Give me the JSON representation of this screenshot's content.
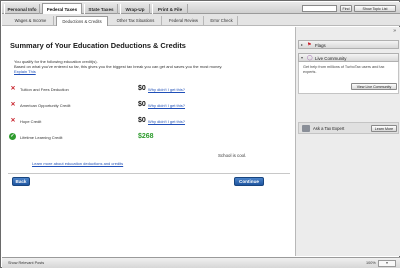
{
  "topbar": {
    "tabs": [
      "Personal Info",
      "Federal Taxes",
      "State Taxes",
      "Wrap-Up",
      "Print & File"
    ],
    "find_label": "Find",
    "topic_list_label": "Show Topic List"
  },
  "subbar": {
    "tabs": [
      "Wages & Income",
      "Deductions & Credits",
      "Other Tax Situations",
      "Federal Review",
      "Error Check"
    ]
  },
  "main": {
    "title": "Summary of Your Education Deductions & Credits",
    "intro1": "You qualify for the following education credit(s).",
    "intro2": "Based on what you've entered so far, this gives you the biggest tax break you can get and saves you the most money.",
    "explain_link": "Explain This",
    "credits": [
      {
        "name": "Tuition and Fees Deduction",
        "amount": "$0",
        "why": "Why didn't I get this?",
        "status": "x"
      },
      {
        "name": "American Opportunity Credit",
        "amount": "$0",
        "why": "Why didn't I get this?",
        "status": "x"
      },
      {
        "name": "Hope Credit",
        "amount": "$0",
        "why": "Why didn't I get this?",
        "status": "x"
      },
      {
        "name": "Lifetime Learning Credit",
        "amount": "$268",
        "why": "",
        "status": "check"
      }
    ],
    "school_note": "School is cool.",
    "more_link": "Learn more about education deductions and credits",
    "back_label": "Back",
    "continue_label": "Continue"
  },
  "sidebar": {
    "arrows": "»",
    "flags_label": "Flags",
    "live_label": "Live Community",
    "live_text": "Get help from millions of TurboTax users and tax experts.",
    "view_community_label": "View Live Community",
    "expert_label": "Ask a Tax Expert",
    "learn_more_label": "Learn More"
  },
  "statusbar": {
    "left": "Show Relevant Posts",
    "zoom": "100%"
  },
  "colors": {
    "accent_blue": "#1f55a0",
    "credit_green": "#2d9b2d",
    "x_red": "#c8202a"
  }
}
